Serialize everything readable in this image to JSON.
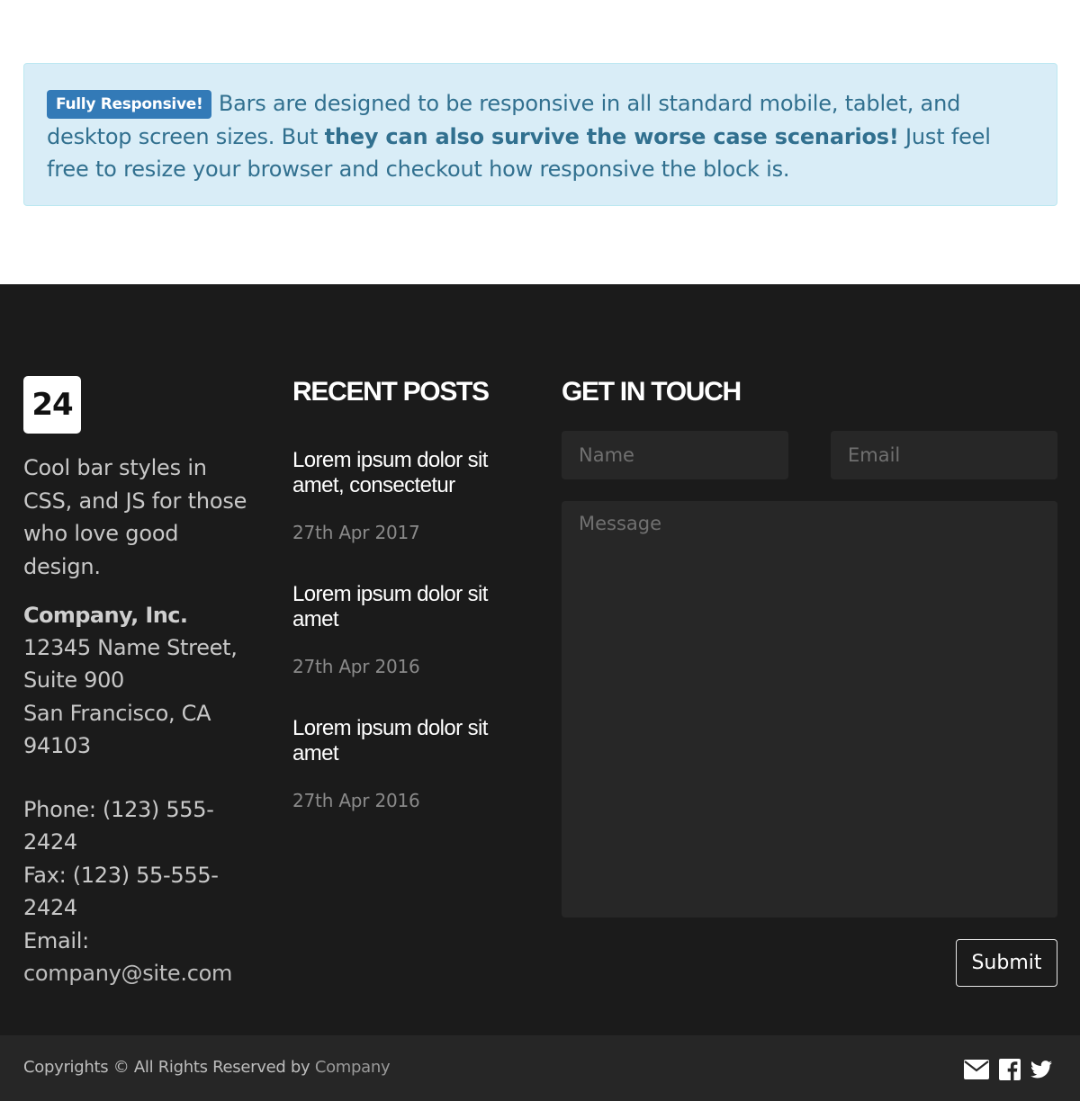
{
  "notice": {
    "badge": "Fully Responsive!",
    "text_before": " Bars are designed to be responsive in all standard mobile, tablet, and desktop screen sizes. But ",
    "text_bold": "they can also survive the worse case scenarios!",
    "text_after": " Just feel free to resize your browser and checkout how responsive the block is."
  },
  "brand": {
    "logo": "24",
    "tagline": "Cool bar styles in CSS, and JS for those who love good design."
  },
  "address": {
    "company": "Company, Inc.",
    "street": "12345 Name Street, Suite 900",
    "city": "San Francisco, CA 94103"
  },
  "contact": {
    "phone": "Phone: (123) 555-2424",
    "fax": "Fax: (123) 55-555-2424",
    "email_label": "Email:",
    "email": "company@site.com"
  },
  "recent_posts": {
    "heading": "RECENT POSTS",
    "items": [
      {
        "title": "Lorem ipsum dolor sit amet, consectetur",
        "date": "27th Apr 2017"
      },
      {
        "title": "Lorem ipsum dolor sit amet",
        "date": "27th Apr 2016"
      },
      {
        "title": "Lorem ipsum dolor sit amet",
        "date": "27th Apr 2016"
      }
    ]
  },
  "form": {
    "heading": "GET IN TOUCH",
    "name_placeholder": "Name",
    "email_placeholder": "Email",
    "message_placeholder": "Message",
    "submit": "Submit"
  },
  "bottom": {
    "copyright": "Copyrights © All Rights Reserved by ",
    "company_link": "Company",
    "icons": [
      "envelope-icon",
      "facebook-icon",
      "twitter-icon"
    ]
  },
  "colors": {
    "alert_bg": "#d9edf7",
    "alert_text": "#31708f",
    "badge": "#337ab7",
    "footer_bg": "#1b1b1b",
    "bottom_bg": "#262626"
  }
}
